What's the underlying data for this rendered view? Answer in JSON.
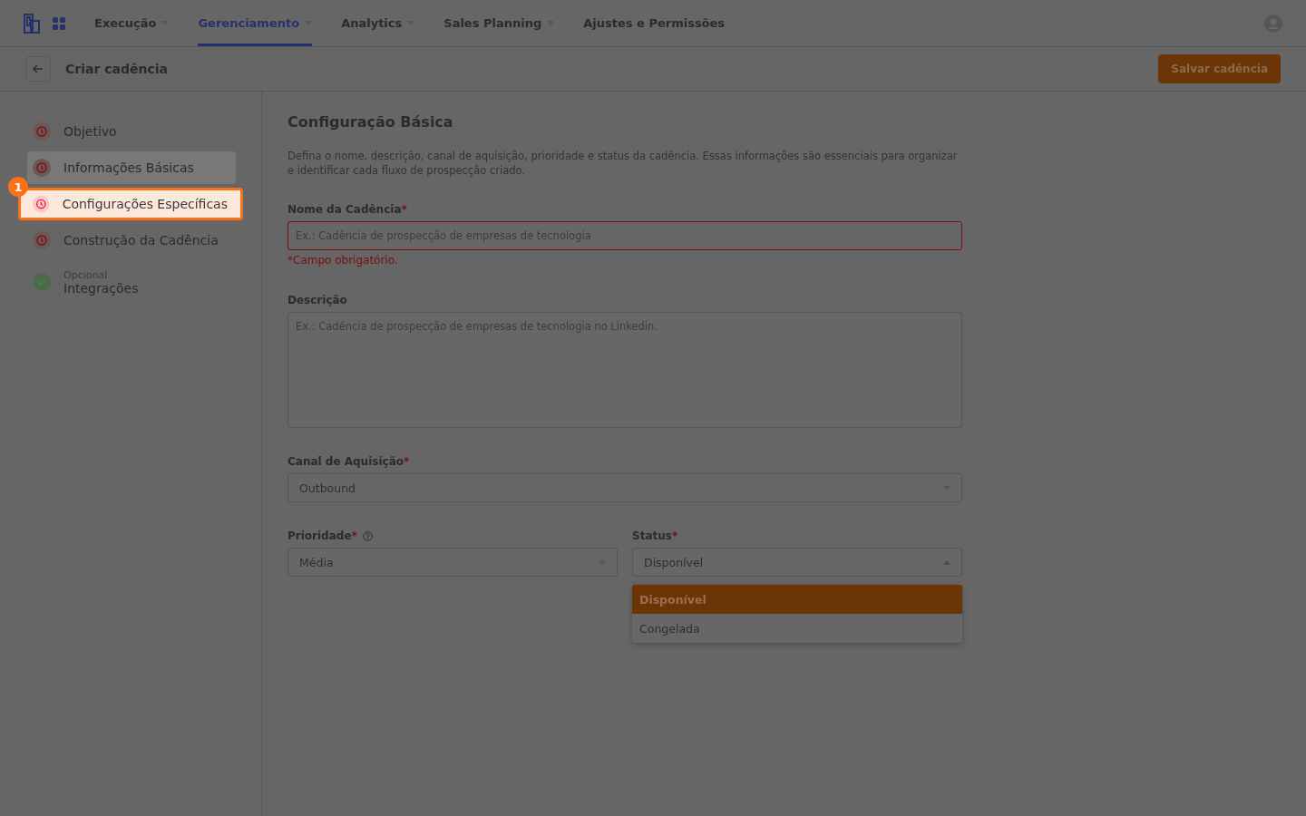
{
  "nav": {
    "items": [
      {
        "label": "Execução",
        "has_menu": true,
        "selected": false
      },
      {
        "label": "Gerenciamento",
        "has_menu": true,
        "selected": true
      },
      {
        "label": "Analytics",
        "has_menu": true,
        "selected": false
      },
      {
        "label": "Sales Planning",
        "has_menu": true,
        "selected": false
      },
      {
        "label": "Ajustes e Permissões",
        "has_menu": false,
        "selected": false
      }
    ]
  },
  "header": {
    "title": "Criar cadência",
    "save_button": "Salvar cadência"
  },
  "steps": [
    {
      "label": "Objetivo",
      "kind": "pending",
      "selected": false,
      "highlighted": false
    },
    {
      "label": "Informações Básicas",
      "kind": "pending",
      "selected": true,
      "highlighted": false
    },
    {
      "label": "Configurações Específicas",
      "kind": "pending",
      "selected": false,
      "highlighted": true,
      "tour_badge": "1"
    },
    {
      "label": "Construção da Cadência",
      "kind": "pending",
      "selected": false,
      "highlighted": false
    },
    {
      "label": "Integrações",
      "caption": "Opcional",
      "kind": "done",
      "selected": false,
      "highlighted": false
    }
  ],
  "form": {
    "title": "Configuração Básica",
    "description": "Defina o nome, descrição, canal de aquisição, prioridade e status da cadência. Essas informações são essenciais para organizar e identificar cada fluxo de prospecção criado.",
    "name_field": {
      "label": "Nome da Cadência",
      "required": "*",
      "placeholder": "Ex.: Cadência de prospecção de empresas de tecnologia",
      "error": "*Campo obrigatório."
    },
    "description_field": {
      "label": "Descrição",
      "placeholder": "Ex.: Cadência de prospecção de empresas de tecnologia no Linkedin."
    },
    "channel_field": {
      "label": "Canal de Aquisição",
      "required": "*",
      "value": "Outbound",
      "expanded": false
    },
    "priority_field": {
      "label": "Prioridade",
      "required": "*",
      "value": "Média",
      "expanded": false
    },
    "status_field": {
      "label": "Status",
      "required": "*",
      "value": "Disponível",
      "expanded": true,
      "options": [
        {
          "label": "Disponível",
          "selected": true
        },
        {
          "label": "Congelada",
          "selected": false
        }
      ]
    }
  }
}
